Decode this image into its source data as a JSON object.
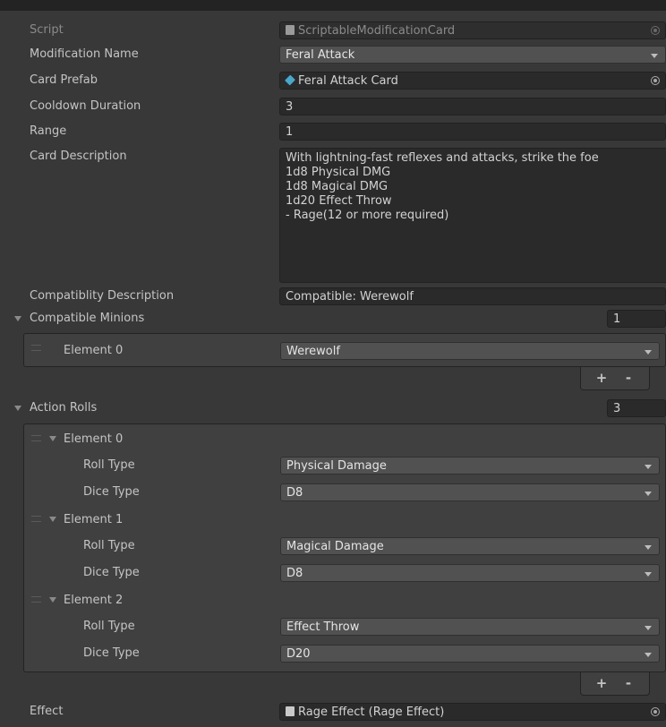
{
  "inspector": {
    "script": {
      "label": "Script",
      "value": "ScriptableModificationCard"
    },
    "modification_name": {
      "label": "Modification Name",
      "value": "Feral Attack"
    },
    "card_prefab": {
      "label": "Card Prefab",
      "value": "Feral Attack Card"
    },
    "cooldown_duration": {
      "label": "Cooldown Duration",
      "value": "3"
    },
    "range": {
      "label": "Range",
      "value": "1"
    },
    "card_description": {
      "label": "Card Description",
      "lines": [
        "With lightning-fast reflexes and attacks, strike the foe",
        "1d8 Physical DMG",
        "1d8 Magical DMG",
        "1d20 Effect Throw",
        "- Rage(12 or more required)"
      ]
    },
    "compatibility_description": {
      "label": "Compatiblity Description",
      "value": "Compatible: Werewolf"
    },
    "compatible_minions": {
      "label": "Compatible Minions",
      "size": "1",
      "elements": [
        {
          "label": "Element 0",
          "value": "Werewolf"
        }
      ],
      "add_label": "+",
      "remove_label": "-"
    },
    "action_rolls": {
      "label": "Action Rolls",
      "size": "3",
      "elements": [
        {
          "label": "Element 0",
          "roll_type_label": "Roll Type",
          "roll_type": "Physical Damage",
          "dice_type_label": "Dice Type",
          "dice_type": "D8"
        },
        {
          "label": "Element 1",
          "roll_type_label": "Roll Type",
          "roll_type": "Magical Damage",
          "dice_type_label": "Dice Type",
          "dice_type": "D8"
        },
        {
          "label": "Element 2",
          "roll_type_label": "Roll Type",
          "roll_type": "Effect Throw",
          "dice_type_label": "Dice Type",
          "dice_type": "D20"
        }
      ],
      "add_label": "+",
      "remove_label": "-"
    },
    "effect": {
      "label": "Effect",
      "value": "Rage Effect (Rage Effect)"
    }
  },
  "icons": {
    "script": "script-icon",
    "prefab": "prefab-cube-icon",
    "asset": "scriptable-asset-icon",
    "object_picker": "object-picker-icon",
    "dropdown": "dropdown-arrow-icon",
    "foldout": "foldout-arrow-icon",
    "drag": "drag-handle-icon"
  },
  "colors": {
    "background": "#383838",
    "field": "#2a2a2a",
    "dropdown": "#515151",
    "text": "#c4c4c4",
    "prefab_icon": "#4aa7c9"
  }
}
